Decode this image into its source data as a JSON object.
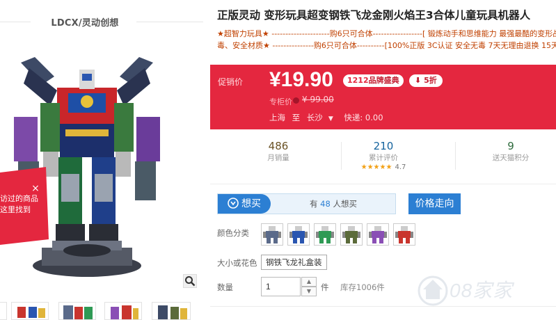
{
  "gallery": {
    "brand_title": "LDCX/灵动创想",
    "popup": {
      "line1": "访过的商品",
      "line2": "这里找到",
      "close": "×"
    }
  },
  "product": {
    "title": "正版灵动 变形玩具超变钢铁飞龙金刚火焰王3合体儿童玩具机器人",
    "subtitle_line1": "★超智力玩具★ ---------------------购6只可合体------------------[ 锻炼动手和思维能力 最强最酷的变形战车",
    "subtitle_line2": "毒、安全材质★ ---------------购6只可合体----------[100%正版 3C认证 安全无毒 7天无理由退换 15天质"
  },
  "price": {
    "promo_label": "促销价",
    "current": "¥19.90",
    "brand_count": "1212",
    "brand_badge": "品牌盛典",
    "discount": "5折",
    "original_label": "专柜价",
    "original": "¥ 99.00",
    "ship_from": "上海",
    "ship_to_word": "至",
    "ship_dest": "长沙",
    "express": "快递: 0.00"
  },
  "stats": {
    "monthly_sales": "486",
    "monthly_sales_label": "月销量",
    "reviews": "210",
    "reviews_label": "累计评价",
    "rating": "4.7",
    "rating_value": 4.7,
    "points": "9",
    "points_label": "送天猫积分"
  },
  "purchase": {
    "buy_label": "想买",
    "want_prefix": "有",
    "want_count": "48",
    "want_suffix": "人想买",
    "trend_label": "价格走向",
    "color_label": "颜色分类",
    "size_label": "大小或花色",
    "size_option": "钢铁飞龙礼盒装",
    "qty_label": "数量",
    "qty_value": "1",
    "qty_unit": "件",
    "stock": "库存1006件"
  },
  "colors": {
    "accent_red": "#e4273f",
    "accent_blue": "#2c7fd3",
    "swatches": [
      "#5a6a8a",
      "#2a56b0",
      "#2f9a55",
      "#5b6b3a",
      "#8a4fb5",
      "#c9352e"
    ]
  },
  "watermark": {
    "text": "08家家"
  }
}
